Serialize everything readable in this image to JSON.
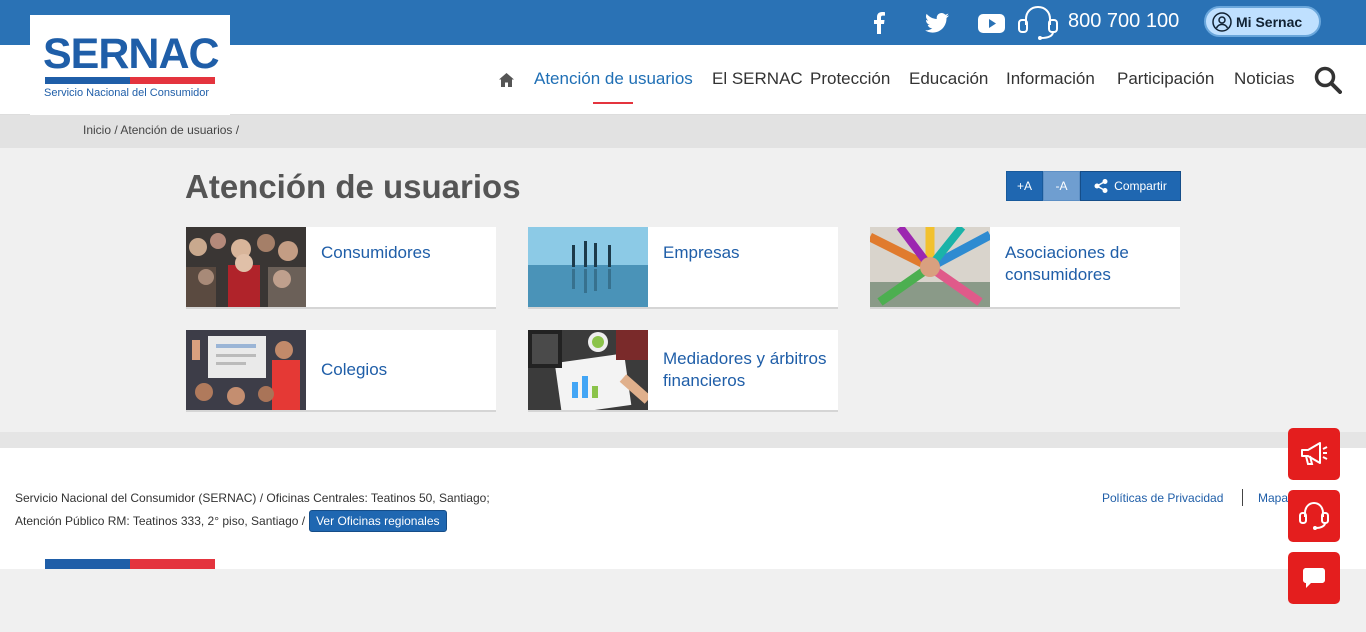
{
  "topbar": {
    "phone": "800 700 100",
    "mi_sernac": "Mi Sernac",
    "social": [
      "facebook-icon",
      "twitter-icon",
      "youtube-icon"
    ]
  },
  "logo": {
    "name": "SERNAC",
    "subtitle": "Servicio Nacional del Consumidor"
  },
  "nav": {
    "items": [
      "Atención de usuarios",
      "El SERNAC",
      "Protección",
      "Educación",
      "Información",
      "Participación",
      "Noticias"
    ],
    "active": "Atención de usuarios"
  },
  "breadcrumb": "Inicio / Atención de usuarios /",
  "page": {
    "title": "Atención de usuarios",
    "font_plus": "+A",
    "font_minus": "-A",
    "share": "Compartir"
  },
  "cards": [
    {
      "label": "Consumidores"
    },
    {
      "label": "Empresas"
    },
    {
      "label": "Asociaciones de consumidores"
    },
    {
      "label": "Colegios"
    },
    {
      "label": "Mediadores y árbitros financieros"
    }
  ],
  "footer": {
    "line1": "Servicio Nacional del Consumidor (SERNAC) / Oficinas Centrales: Teatinos 50, Santiago;",
    "line2": "Atención Público RM: Teatinos 333, 2° piso, Santiago /",
    "offices_button": "Ver Oficinas regionales",
    "privacy": "Políticas de Privacidad",
    "sitemap": "Mapa"
  },
  "colors": {
    "brand_blue": "#2a72b5",
    "accent_red": "#e41e1e"
  }
}
